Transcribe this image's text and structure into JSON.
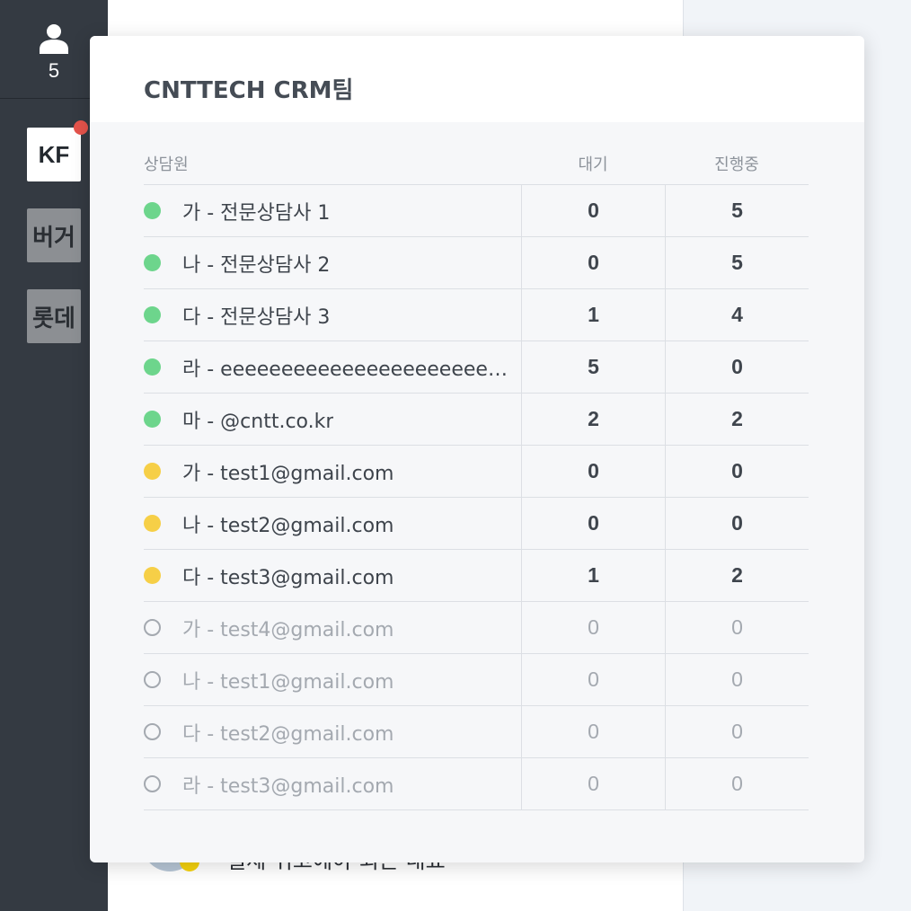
{
  "sidebar": {
    "agent_count": "5",
    "teams": [
      {
        "label": "KF",
        "active": true,
        "has_notification": true
      },
      {
        "label": "버거",
        "active": false
      },
      {
        "label": "롯데",
        "active": false
      }
    ]
  },
  "background": {
    "partial_text": "실제 위고에야 되는 내표"
  },
  "popup": {
    "title": "CNTTECH CRM팀",
    "columns": {
      "agent": "상담원",
      "waiting": "대기",
      "in_progress": "진행중"
    },
    "rows": [
      {
        "status": "online",
        "name": "가 - 전문상담사 1",
        "waiting": "0",
        "in_progress": "5"
      },
      {
        "status": "online",
        "name": "나 - 전문상담사 2",
        "waiting": "0",
        "in_progress": "5"
      },
      {
        "status": "online",
        "name": "다 - 전문상담사 3",
        "waiting": "1",
        "in_progress": "4"
      },
      {
        "status": "online",
        "name": "라 - eeeeeeeeeeeeeeeeeeeeeeeeeeeeeeeeeee",
        "waiting": "5",
        "in_progress": "0"
      },
      {
        "status": "online",
        "name": "마 - @cntt.co.kr",
        "waiting": "2",
        "in_progress": "2"
      },
      {
        "status": "busy",
        "name": "가 - test1@gmail.com",
        "waiting": "0",
        "in_progress": "0"
      },
      {
        "status": "busy",
        "name": "나 - test2@gmail.com",
        "waiting": "0",
        "in_progress": "0"
      },
      {
        "status": "busy",
        "name": "다 - test3@gmail.com",
        "waiting": "1",
        "in_progress": "2"
      },
      {
        "status": "offline",
        "name": "가 - test4@gmail.com",
        "waiting": "0",
        "in_progress": "0"
      },
      {
        "status": "offline",
        "name": "나 - test1@gmail.com",
        "waiting": "0",
        "in_progress": "0"
      },
      {
        "status": "offline",
        "name": "다 - test2@gmail.com",
        "waiting": "0",
        "in_progress": "0"
      },
      {
        "status": "offline",
        "name": "라 - test3@gmail.com",
        "waiting": "0",
        "in_progress": "0"
      }
    ]
  },
  "colors": {
    "sidebar_bg": "#343a42",
    "online": "#6dd58c",
    "busy": "#f6cf47",
    "offline": "#a4a9b0",
    "notification": "#e5534b"
  }
}
